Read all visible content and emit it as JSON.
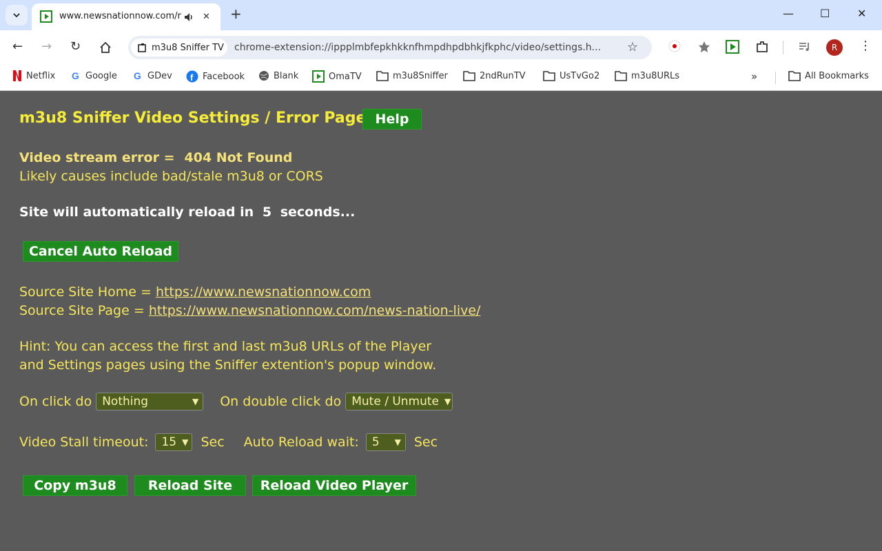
{
  "browser": {
    "tab_title": "www.newsnationnow.com/r",
    "chip_label": "m3u8 Sniffer TV",
    "url": "chrome-extension://ippplmbfepkhkknfhmpdhpdbhkjfkphc/video/settings.h...",
    "avatar_initial": "R",
    "bookmarks": [
      {
        "label": "Netflix"
      },
      {
        "label": "Google"
      },
      {
        "label": "GDev"
      },
      {
        "label": "Facebook"
      },
      {
        "label": "Blank"
      },
      {
        "label": "OmaTV"
      },
      {
        "label": "m3u8Sniffer"
      },
      {
        "label": "2ndRunTV"
      },
      {
        "label": "UsTvGo2"
      },
      {
        "label": "m3u8URLs"
      }
    ],
    "all_bookmarks": "All Bookmarks"
  },
  "page": {
    "title": "m3u8 Sniffer Video Settings / Error Page",
    "help_label": "Help",
    "error_label": "Video stream error =",
    "error_value": "404 Not Found",
    "cause": "Likely causes include bad/stale m3u8 or CORS",
    "reload_prefix": "Site will automatically reload in",
    "reload_seconds": "5",
    "reload_suffix": "seconds...",
    "cancel_label": "Cancel Auto Reload",
    "source_home_label": "Source Site Home =",
    "source_home_url": "https://www.newsnationnow.com",
    "source_page_label": "Source Site Page =",
    "source_page_url": "https://www.newsnationnow.com/news-nation-live/",
    "hint_line1": "Hint: You can access the first and last m3u8 URLs of the Player",
    "hint_line2": "and Settings pages using the Sniffer extention's popup window.",
    "click_label": "On click do",
    "click_value": "Nothing",
    "dblclick_label": "On double click do",
    "dblclick_value": "Mute / Unmute",
    "stall_label": "Video Stall timeout:",
    "stall_value": "15",
    "sec_label": "Sec",
    "wait_label": "Auto Reload wait:",
    "wait_value": "5",
    "copy_label": "Copy m3u8",
    "reload_site_label": "Reload Site",
    "reload_player_label": "Reload Video Player"
  },
  "colors": {
    "page_bg": "#5a5a5a",
    "heading": "#f6ec3a",
    "text": "#f5e65a",
    "button_bg": "#1e8b1e"
  }
}
